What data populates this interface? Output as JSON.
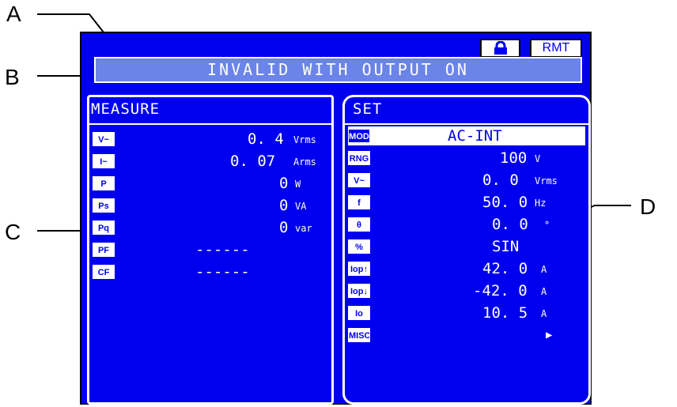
{
  "callouts": {
    "a": "A",
    "b": "B",
    "c": "C",
    "d": "D"
  },
  "status": {
    "lock_icon": "lock-icon",
    "remote": "RMT"
  },
  "message": "INVALID WITH OUTPUT ON",
  "measure": {
    "title": "MEASURE",
    "rows": [
      {
        "tag": "V~",
        "value": "0. 4",
        "unit": "Vrms"
      },
      {
        "tag": "I~",
        "value": "0. 07",
        "unit": "Arms"
      },
      {
        "tag": "P",
        "value": "0",
        "unit": "W"
      },
      {
        "tag": "Ps",
        "value": "0",
        "unit": "VA"
      },
      {
        "tag": "Pq",
        "value": "0",
        "unit": "var"
      },
      {
        "tag": "PF",
        "value": "------",
        "unit": ""
      },
      {
        "tag": "CF",
        "value": "------",
        "unit": ""
      }
    ]
  },
  "set": {
    "title": "SET",
    "rows": [
      {
        "tag": "MOD",
        "value": "AC-INT",
        "unit": ""
      },
      {
        "tag": "RNG",
        "value": "100",
        "unit": "V"
      },
      {
        "tag": "V~",
        "value": "0. 0",
        "unit": "Vrms"
      },
      {
        "tag": "f",
        "value": "50. 0",
        "unit": "Hz"
      },
      {
        "tag": "θ",
        "value": "0. 0",
        "unit": "°"
      },
      {
        "tag": "%",
        "value": "SIN",
        "unit": ""
      },
      {
        "tag": "Iop↑",
        "value": "42. 0",
        "unit": "A"
      },
      {
        "tag": "Iop↓",
        "value": "-42. 0",
        "unit": "A"
      },
      {
        "tag": "Io",
        "value": "10. 5",
        "unit": "A"
      },
      {
        "tag": "MISC",
        "value": "▶",
        "unit": ""
      }
    ]
  },
  "colors": {
    "screen": "#0000ee",
    "message_bar": "#6b84e8",
    "foreground": "#ffffff"
  }
}
